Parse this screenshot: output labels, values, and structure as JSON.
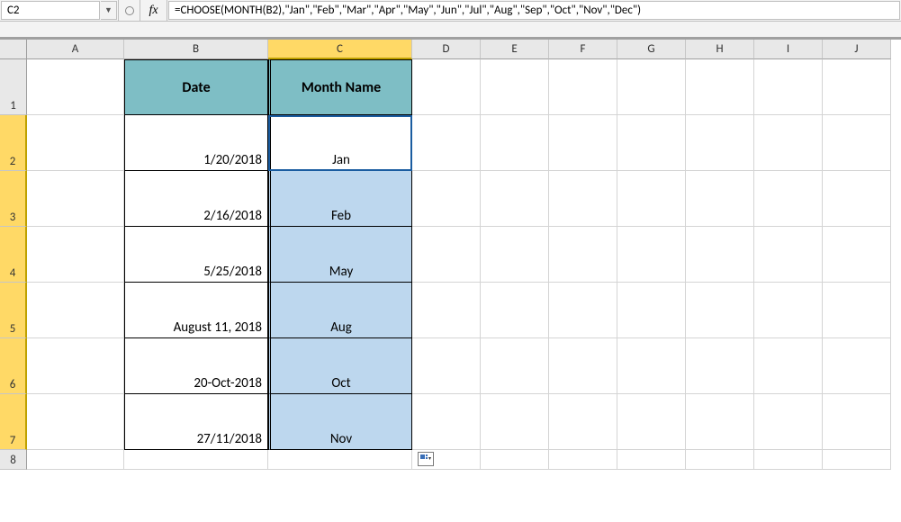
{
  "name_box": "C2",
  "fx_label": "fx",
  "formula": "=CHOOSE(MONTH(B2),\"Jan\",\"Feb\",\"Mar\",\"Apr\",\"May\",\"Jun\",\"Jul\",\"Aug\",\"Sep\",\"Oct\",\"Nov\",\"Dec\")",
  "columns": [
    "A",
    "B",
    "C",
    "D",
    "E",
    "F",
    "G",
    "H",
    "I",
    "J"
  ],
  "selected_column": "C",
  "rows": [
    "1",
    "2",
    "3",
    "4",
    "5",
    "6",
    "7",
    "8"
  ],
  "selected_rows": [
    "2",
    "3",
    "4",
    "5",
    "6",
    "7"
  ],
  "th": {
    "b": "Date",
    "c": "Month Name"
  },
  "data": {
    "b2": "1/20/2018",
    "c2": "Jan",
    "b3": "2/16/2018",
    "c3": "Feb",
    "b4": "5/25/2018",
    "c4": "May",
    "b5": "August 11, 2018",
    "c5": "Aug",
    "b6": "20-Oct-2018",
    "c6": "Oct",
    "b7": "27/11/2018",
    "c7": "Nov"
  },
  "colors": {
    "header_teal": "#7ebec5",
    "sel_yellow": "#ffd966",
    "hl_blue": "#bdd7ee"
  }
}
